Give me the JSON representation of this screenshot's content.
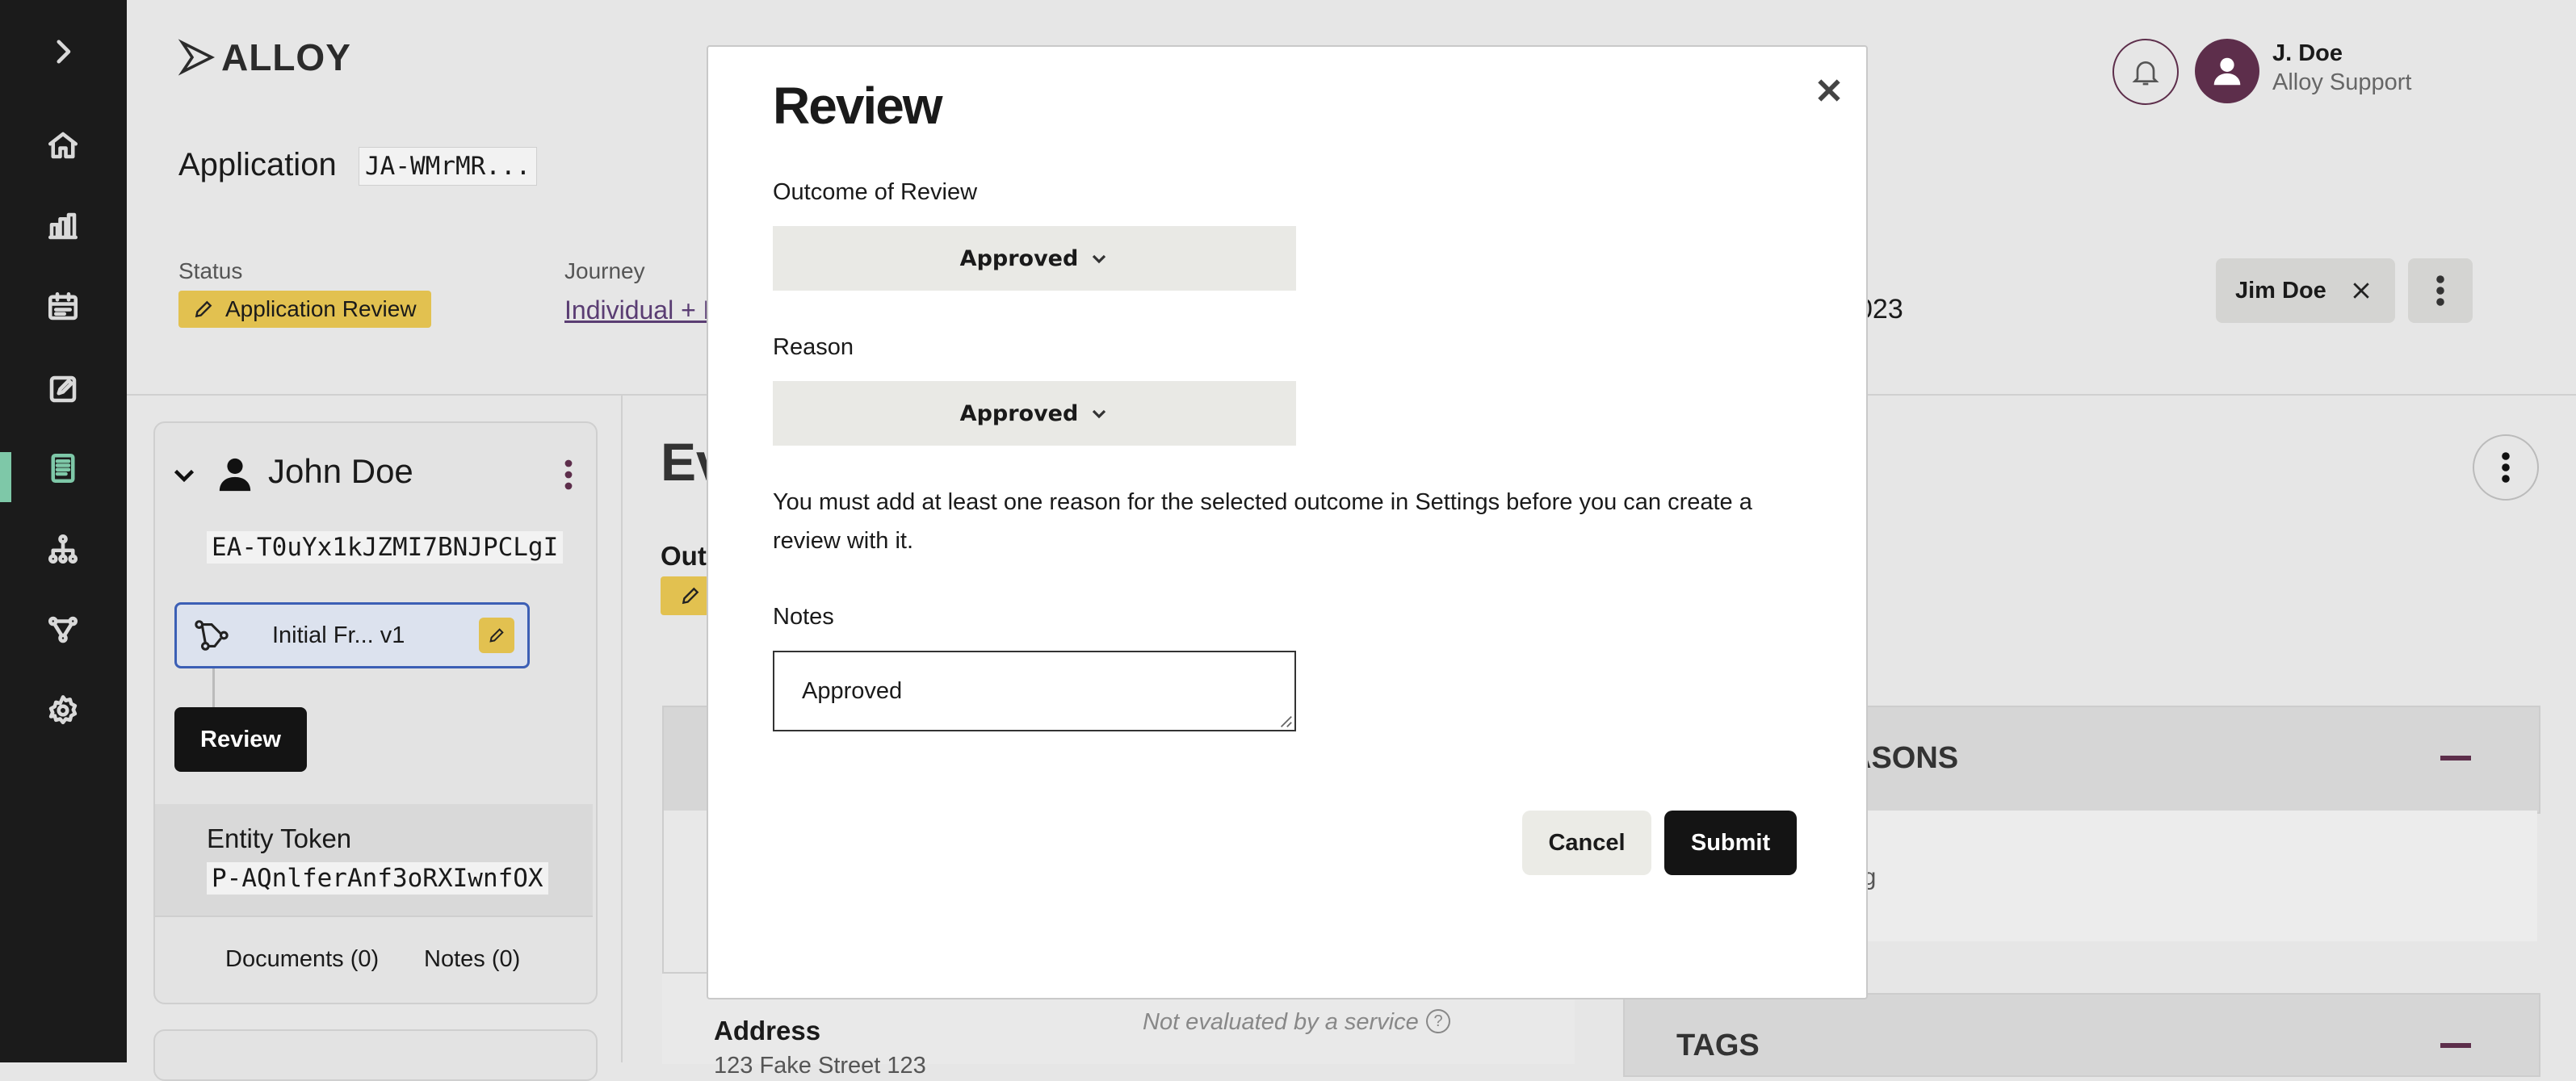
{
  "brand": {
    "logo_text": "ALLOY"
  },
  "header": {
    "application_label": "Application",
    "application_id": "JA-WMrMR...",
    "status_label": "Status",
    "status_badge": "Application Review",
    "journey_label": "Journey",
    "journey_link": "Individual + B",
    "date_fragment": "023",
    "assignee_chip": "Jim Doe",
    "user_name": "J. Doe",
    "user_org": "Alloy Support"
  },
  "entity_panel": {
    "name": "John Doe",
    "entity_id": "EA-T0uYx1kJZMI7BNJPCLgI",
    "workflow_label": "Initial Fr... v1",
    "review_button": "Review",
    "entity_token_label": "Entity Token",
    "entity_token_value": "P-AQnlferAnf3oRXIwnfOX",
    "documents_link": "Documents (0)",
    "notes_link": "Notes (0)"
  },
  "main": {
    "heading_fragment": "Ev",
    "outcome_fragment": "Out",
    "reasons_fragment": "ASONS",
    "reasons_body_fragment": "ng",
    "address_label": "Address",
    "address_status": "Not evaluated by a service",
    "address_value_fragment": "123 Fake Street 123",
    "tags_label": "TAGS"
  },
  "modal": {
    "title": "Review",
    "outcome_label": "Outcome of Review",
    "outcome_value": "Approved",
    "reason_label": "Reason",
    "reason_value": "Approved",
    "info_text": "You must add at least one reason for the selected outcome in Settings before you can create a review with it.",
    "notes_label": "Notes",
    "notes_value": "Approved",
    "cancel_label": "Cancel",
    "submit_label": "Submit"
  },
  "colors": {
    "rail": "#1b1b1b",
    "rail_active": "#7ec8a8",
    "status_badge": "#e2c150",
    "primary_button": "#141414",
    "link": "#5a3d73",
    "avatar": "#5d2e4b"
  },
  "icons": [
    "chevron-right-icon",
    "home-icon",
    "bar-chart-icon",
    "calendar-icon",
    "edit-square-icon",
    "document-icon",
    "hierarchy-icon",
    "workflow-icon",
    "gear-icon",
    "bell-icon",
    "avatar-icon",
    "close-icon",
    "kebab-icon",
    "pencil-icon",
    "chevron-down-icon",
    "person-icon",
    "minus-icon",
    "help-icon"
  ]
}
